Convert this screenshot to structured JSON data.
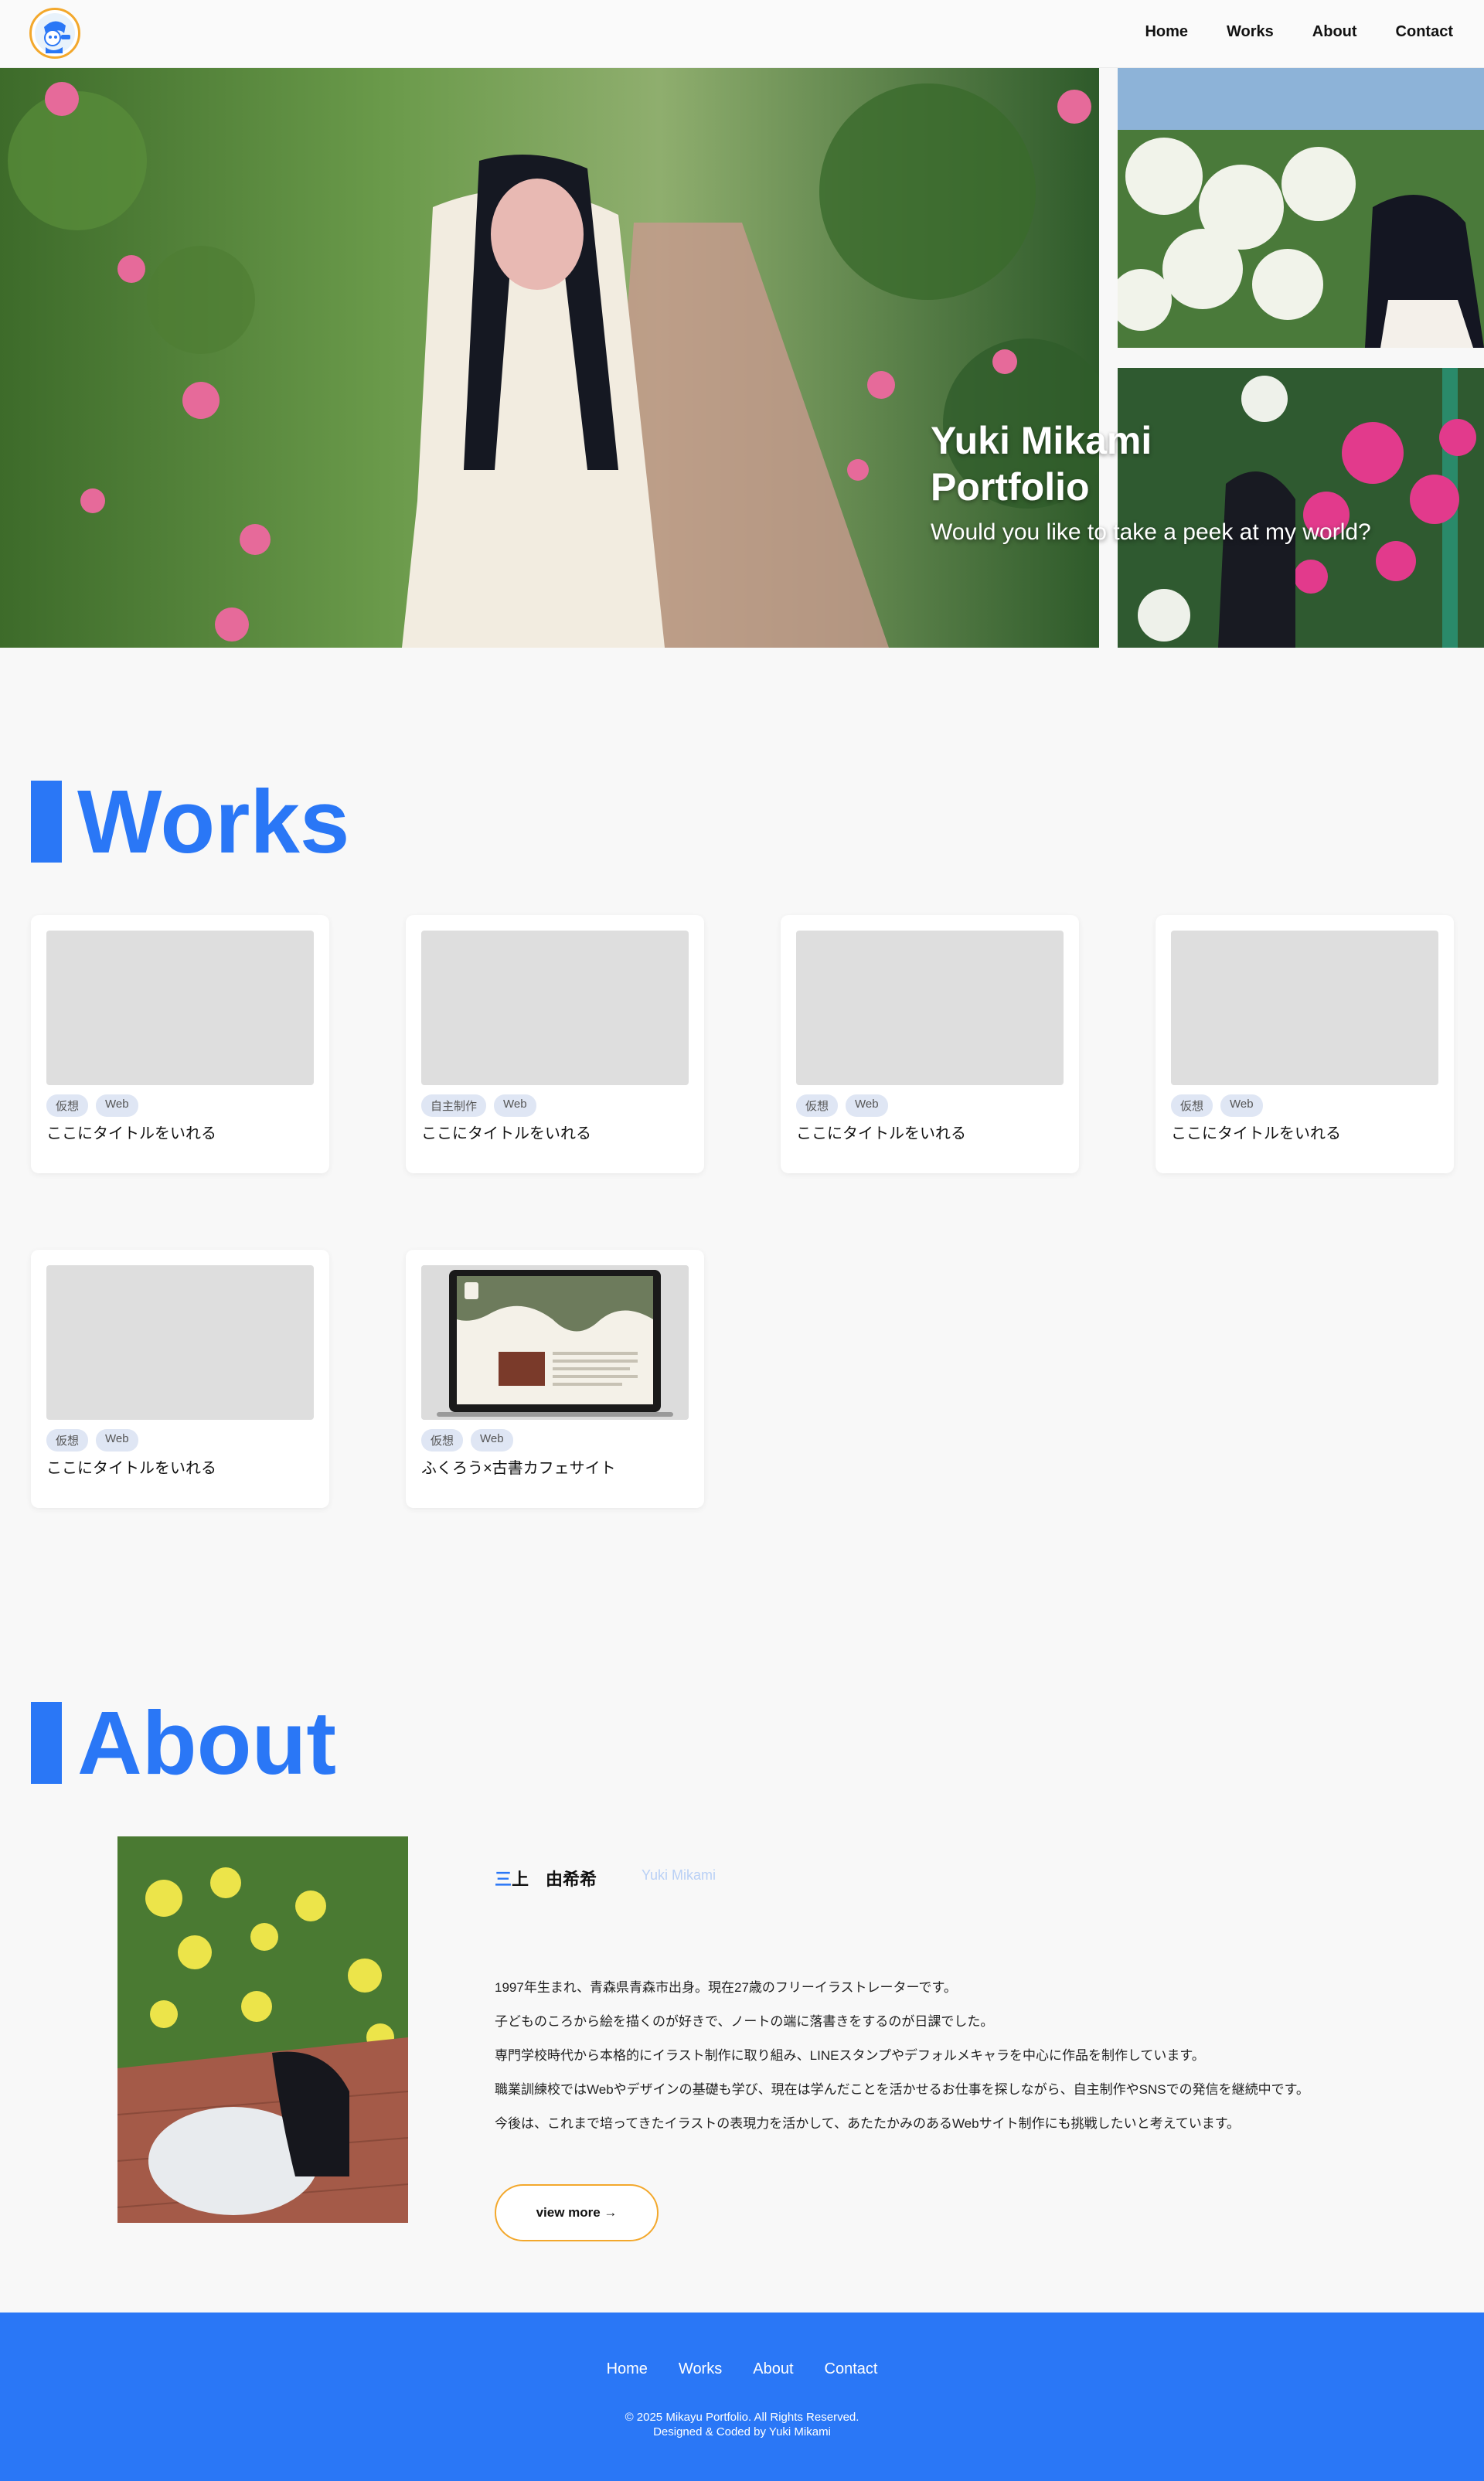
{
  "header": {
    "logo_alt": "Mikayu logo",
    "nav": [
      "Home",
      "Works",
      "About",
      "Contact"
    ]
  },
  "hero": {
    "title_line1": "Yuki Mikami",
    "title_line2": "Portfolio",
    "subtitle": "Would you like to take a peek at my world?"
  },
  "works": {
    "heading": "Works",
    "cards": [
      {
        "tags": [
          "仮想",
          "Web"
        ],
        "title": "ここにタイトルをいれる"
      },
      {
        "tags": [
          "自主制作",
          "Web"
        ],
        "title": "ここにタイトルをいれる"
      },
      {
        "tags": [
          "仮想",
          "Web"
        ],
        "title": "ここにタイトルをいれる"
      },
      {
        "tags": [
          "仮想",
          "Web"
        ],
        "title": "ここにタイトルをいれる"
      },
      {
        "tags": [
          "仮想",
          "Web"
        ],
        "title": "ここにタイトルをいれる"
      },
      {
        "tags": [
          "仮想",
          "Web"
        ],
        "title": "ふくろう×古書カフェサイト"
      }
    ]
  },
  "about": {
    "heading": "About",
    "name_accent": "三",
    "name_rest": "上　由希希",
    "name_en": "Yuki Mikami",
    "paragraphs": [
      "1997年生まれ、青森県青森市出身。現在27歳のフリーイラストレーターです。",
      "子どものころから絵を描くのが好きで、ノートの端に落書きをするのが日課でした。",
      "専門学校時代から本格的にイラスト制作に取り組み、LINEスタンプやデフォルメキャラを中心に作品を制作しています。",
      "職業訓練校ではWebやデザインの基礎も学び、現在は学んだことを活かせるお仕事を探しながら、自主制作やSNSでの発信を継続中です。",
      "今後は、これまで培ってきたイラストの表現力を活かして、あたたかみのあるWebサイト制作にも挑戦したいと考えています。"
    ],
    "view_more": "view more →"
  },
  "footer": {
    "nav": [
      "Home",
      "Works",
      "About",
      "Contact"
    ],
    "copyright": "© 2025 Mikayu Portfolio. All Rights Reserved.",
    "credit": "Designed & Coded by Yuki Mikami"
  },
  "colors": {
    "accent": "#2a77f6",
    "button_border": "#f3a82c",
    "tag_bg": "#dfe6f4"
  }
}
